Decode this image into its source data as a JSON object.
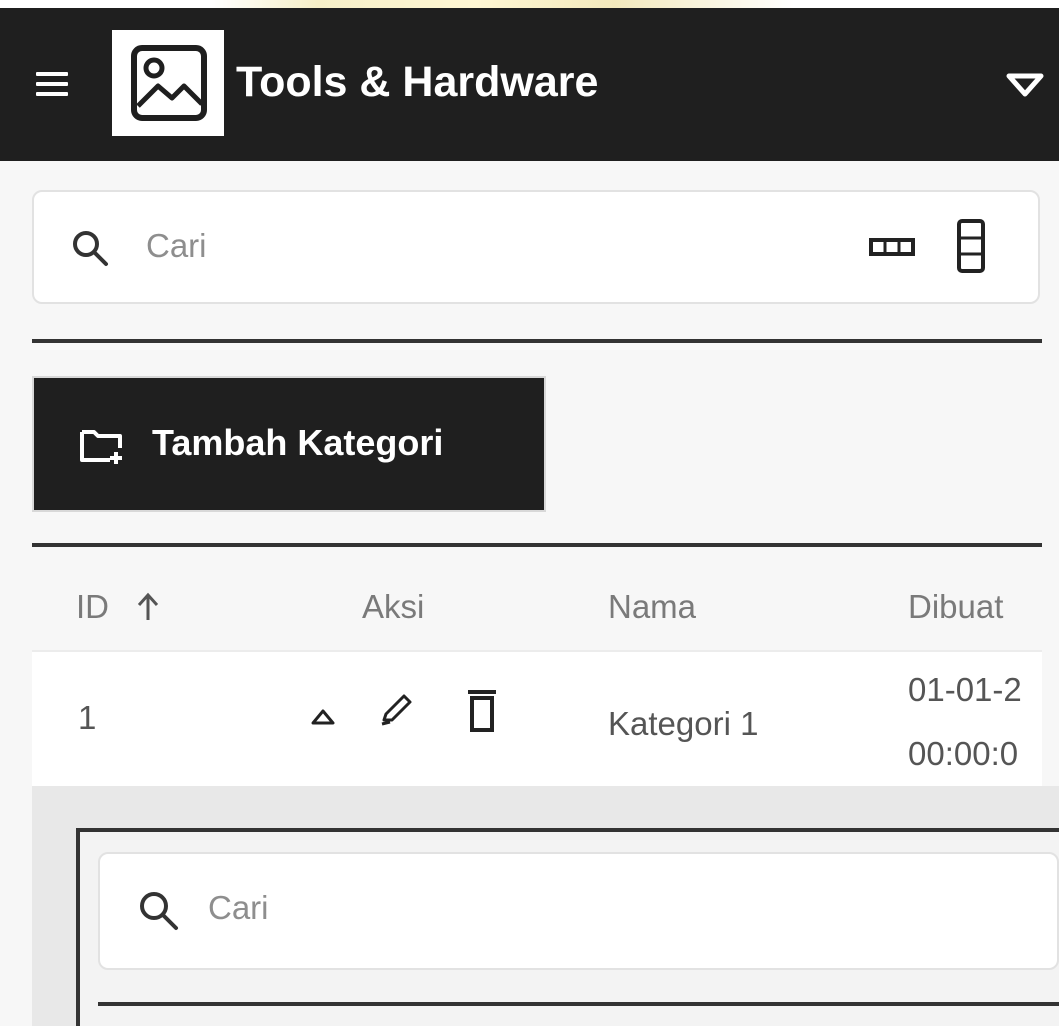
{
  "header": {
    "title": "Tools & Hardware",
    "menu_icon": "hamburger-icon",
    "logo_icon": "image-placeholder-icon",
    "dropdown_icon": "caret-down-icon",
    "background_color": "#1f1f1f"
  },
  "search": {
    "placeholder": "Cari",
    "icon": "search-icon"
  },
  "toolbar": {
    "density_icon": "density-icon",
    "columns_icon": "columns-icon",
    "add_category_label": "Tambah Kategori",
    "add_category_icon": "folder-add-icon"
  },
  "table": {
    "columns": [
      {
        "label": "ID",
        "sort": "ascending"
      },
      {
        "label": "Aksi"
      },
      {
        "label": "Nama"
      },
      {
        "label": "Dibuat"
      }
    ],
    "rows": [
      {
        "id": "1",
        "actions": [
          "collapse-icon",
          "edit-icon",
          "delete-icon"
        ],
        "name": "Kategori 1",
        "created_line1": "01-01-2",
        "created_line2": "00:00:0"
      }
    ]
  },
  "detail_panel": {
    "search_placeholder": "Cari"
  }
}
